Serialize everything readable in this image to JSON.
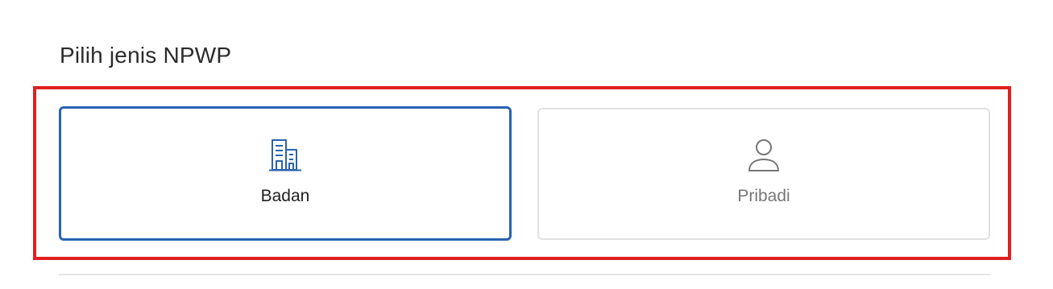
{
  "section": {
    "title": "Pilih jenis NPWP"
  },
  "options": [
    {
      "label": "Badan",
      "icon": "building-icon",
      "selected": true,
      "color": "#2a62b0"
    },
    {
      "label": "Pribadi",
      "icon": "person-icon",
      "selected": false,
      "color": "#767676"
    }
  ],
  "colors": {
    "highlight_frame": "#e0201f",
    "selected_border": "#2a62b0",
    "unselected_border": "#e1e1e1"
  }
}
